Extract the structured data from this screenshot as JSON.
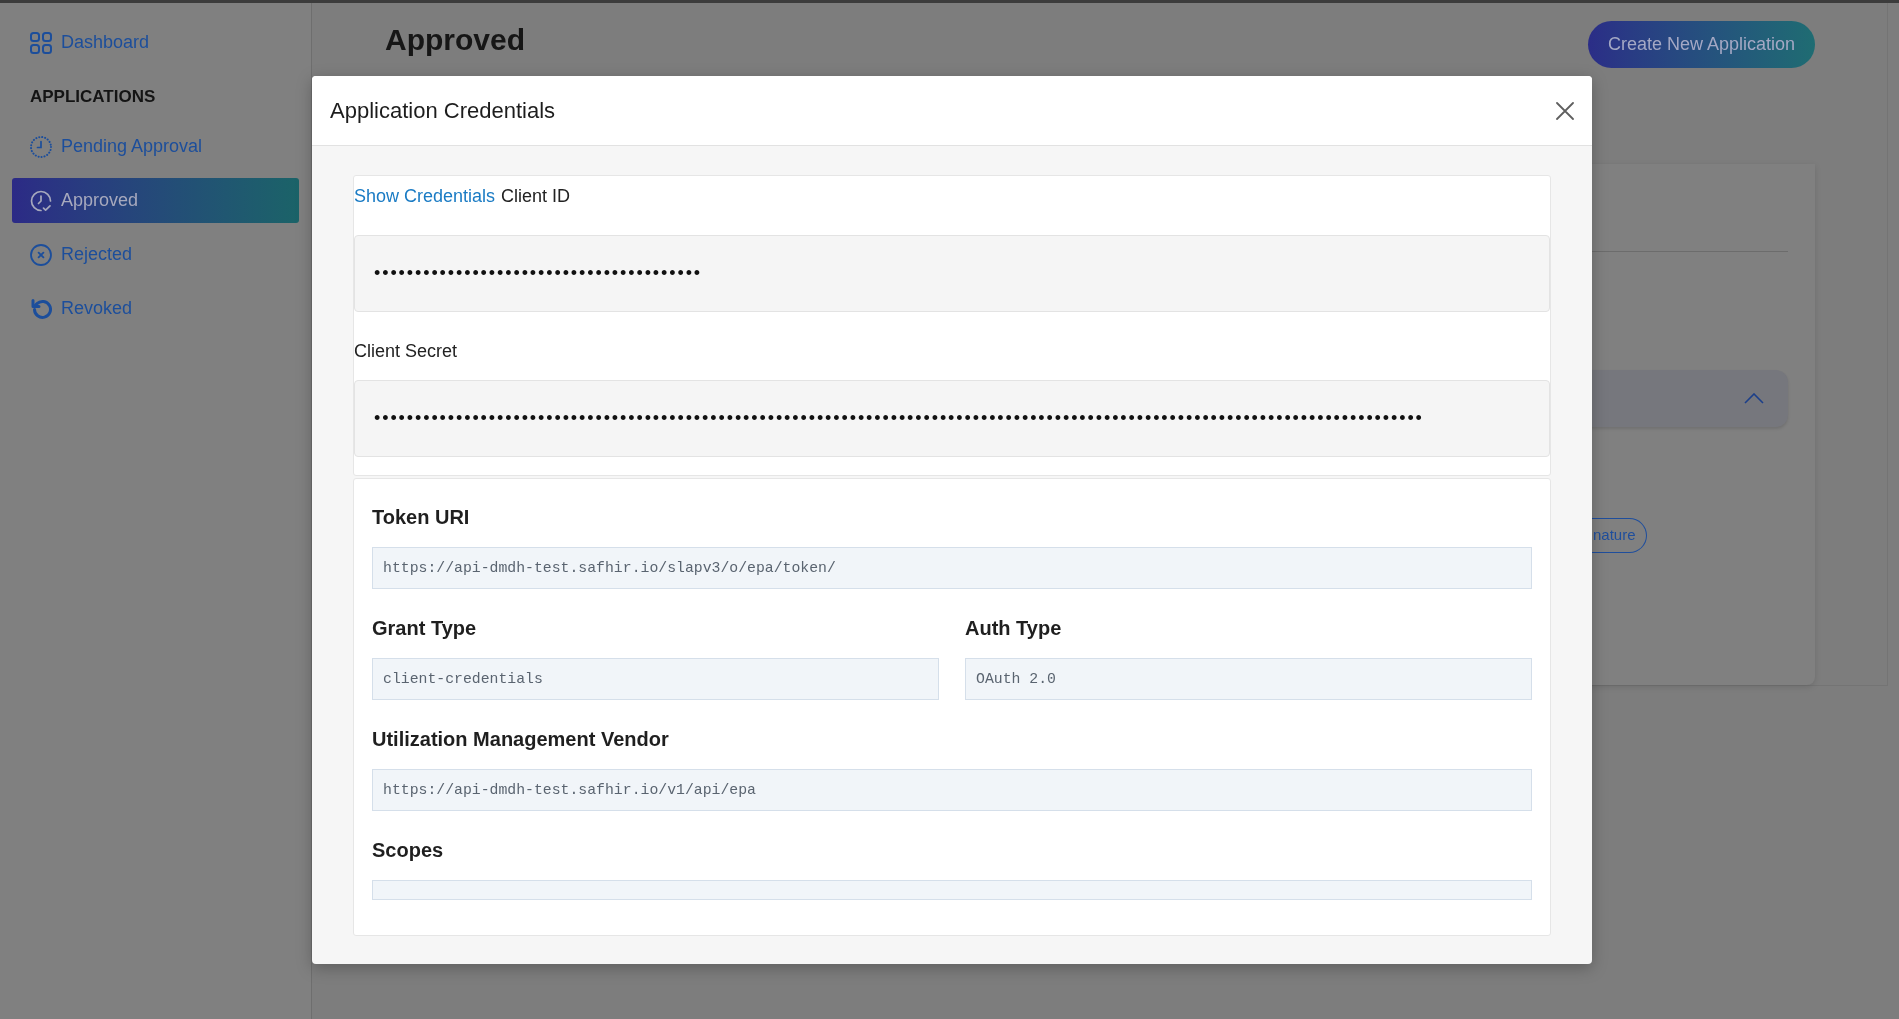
{
  "sidebar": {
    "dashboard_link": "Dashboard",
    "section_title": "APPLICATIONS",
    "items": [
      {
        "label": "Pending Approval",
        "selected": false
      },
      {
        "label": "Approved",
        "selected": true
      },
      {
        "label": "Rejected",
        "selected": false
      },
      {
        "label": "Revoked",
        "selected": false
      }
    ]
  },
  "page": {
    "title": "Approved",
    "create_button": "Create New Application",
    "tag": "nature"
  },
  "modal": {
    "title": "Application Credentials",
    "show_credentials_link": "Show Credentials",
    "credentials": [
      {
        "label": "Client ID",
        "value": "••••••••••••••••••••••••••••••••••••••••"
      },
      {
        "label": "Client Secret",
        "value": "••••••••••••••••••••••••••••••••••••••••••••••••••••••••••••••••••••••••••••••••••••••••••••••••••••••••••••••••••••••••••••••••"
      }
    ],
    "details": [
      {
        "kind": "wide",
        "label": "Token URI",
        "value": "https://api-dmdh-test.safhir.io/slapv3/o/epa/token/"
      },
      {
        "kind": "half",
        "label": "Grant Type",
        "value": "client-credentials"
      },
      {
        "kind": "half",
        "label": "Auth Type",
        "value": "OAuth 2.0"
      },
      {
        "kind": "wide",
        "label": "Utilization Management Vendor",
        "value": "https://api-dmdh-test.safhir.io/v1/api/epa"
      },
      {
        "kind": "wide",
        "label": "Scopes"
      }
    ]
  }
}
